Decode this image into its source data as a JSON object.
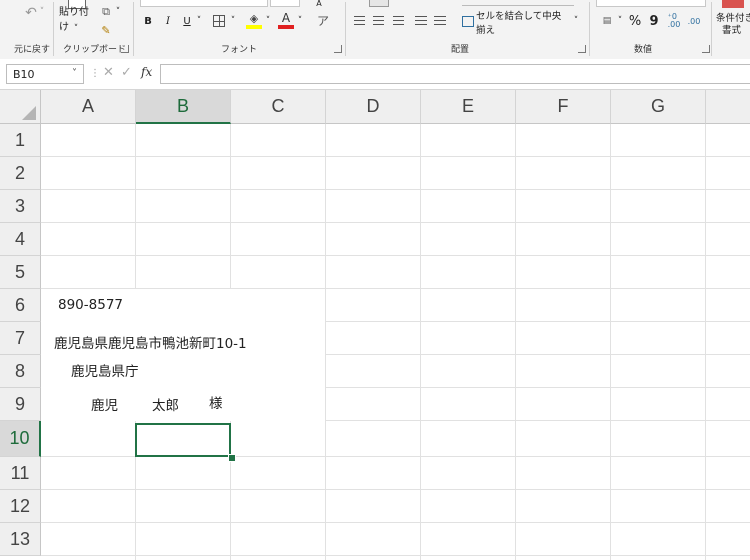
{
  "ribbon": {
    "undo_group_label": "元に戻す",
    "clipboard": {
      "label": "クリップボード",
      "paste_label": "貼り付け"
    },
    "font": {
      "label": "フォント",
      "bold": "B",
      "italic": "I",
      "underline": "U"
    },
    "alignment": {
      "label": "配置",
      "merge_center_label": "セルを結合して中央揃え"
    },
    "number": {
      "label": "数値",
      "percent": "%",
      "comma": "9"
    },
    "styles": {
      "conditional_label_1": "条件付き",
      "conditional_label_2": "書式"
    }
  },
  "formula_bar": {
    "name_box": "B10",
    "fx_label": "fx",
    "formula_value": ""
  },
  "columns": [
    "A",
    "B",
    "C",
    "D",
    "E",
    "F",
    "G"
  ],
  "rows": [
    "1",
    "2",
    "3",
    "4",
    "5",
    "6",
    "7",
    "8",
    "9",
    "10",
    "11",
    "12",
    "13"
  ],
  "selected_cell": "B10",
  "cells": {
    "postal_code": "890-8577",
    "address": "鹿児島県鹿児島市鴨池新町10-1",
    "organization": "鹿児島県庁",
    "surname": "鹿児",
    "given_name": "太郎",
    "honorific": "様"
  },
  "colors": {
    "accent": "#217346",
    "font_color_bar": "#e02020",
    "highlight_bar": "#ffff00"
  }
}
